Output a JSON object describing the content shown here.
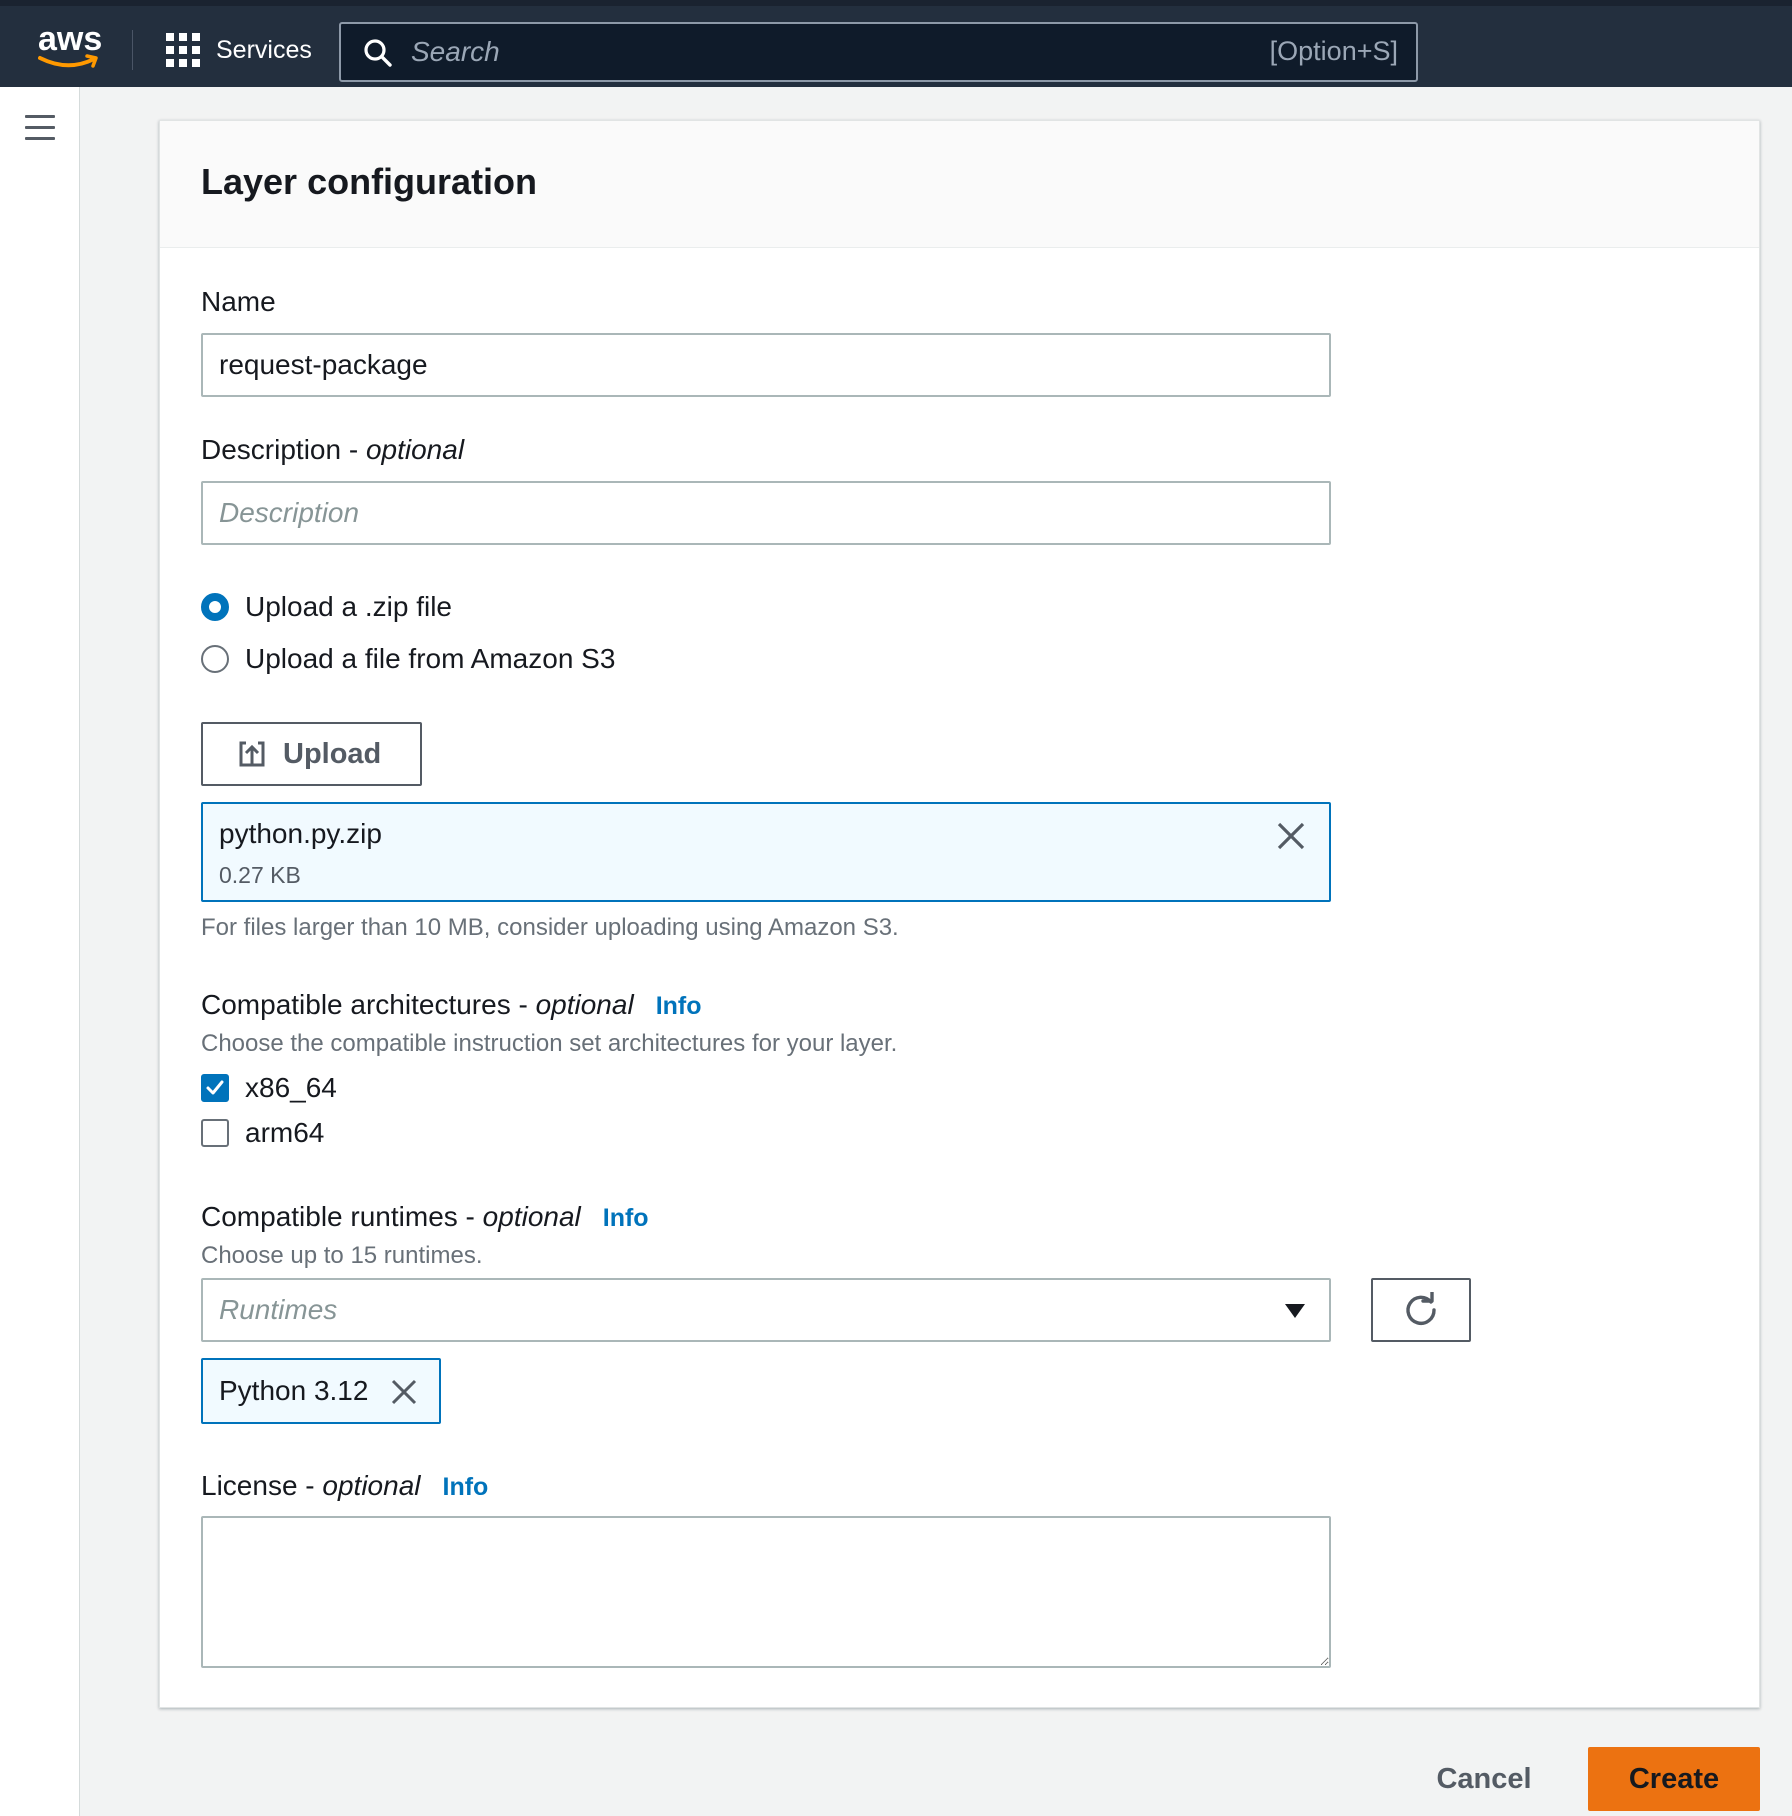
{
  "topnav": {
    "logo_text": "aws",
    "services_label": "Services",
    "search": {
      "placeholder": "Search",
      "shortcut": "[Option+S]"
    }
  },
  "panel": {
    "title": "Layer configuration",
    "name": {
      "label": "Name",
      "value": "request-package"
    },
    "description": {
      "label": "Description",
      "optional": "optional",
      "separator": " - ",
      "placeholder": "Description"
    },
    "upload_options": [
      {
        "label": "Upload a .zip file",
        "selected": true
      },
      {
        "label": "Upload a file from Amazon S3",
        "selected": false
      }
    ],
    "upload_button": "Upload",
    "file": {
      "name": "python.py.zip",
      "size": "0.27 KB"
    },
    "file_hint": "For files larger than 10 MB, consider uploading using Amazon S3.",
    "architectures": {
      "label": "Compatible architectures",
      "optional": "optional",
      "info": "Info",
      "hint": "Choose the compatible instruction set architectures for your layer.",
      "options": [
        {
          "label": "x86_64",
          "checked": true
        },
        {
          "label": "arm64",
          "checked": false
        }
      ]
    },
    "runtimes": {
      "label": "Compatible runtimes",
      "optional": "optional",
      "info": "Info",
      "hint": "Choose up to 15 runtimes.",
      "placeholder": "Runtimes",
      "selected": [
        "Python 3.12"
      ]
    },
    "license": {
      "label": "License",
      "optional": "optional",
      "info": "Info",
      "value": ""
    }
  },
  "actions": {
    "cancel": "Cancel",
    "create": "Create"
  },
  "colors": {
    "accent": "#0073bb",
    "primary_button": "#ec7211",
    "nav_bg": "#232f3e",
    "smile": "#ff9900"
  },
  "icons": [
    "grid-icon",
    "search-icon",
    "hamburger-icon",
    "upload-icon",
    "close-icon",
    "caret-down-icon",
    "refresh-icon",
    "checkmark-icon"
  ]
}
